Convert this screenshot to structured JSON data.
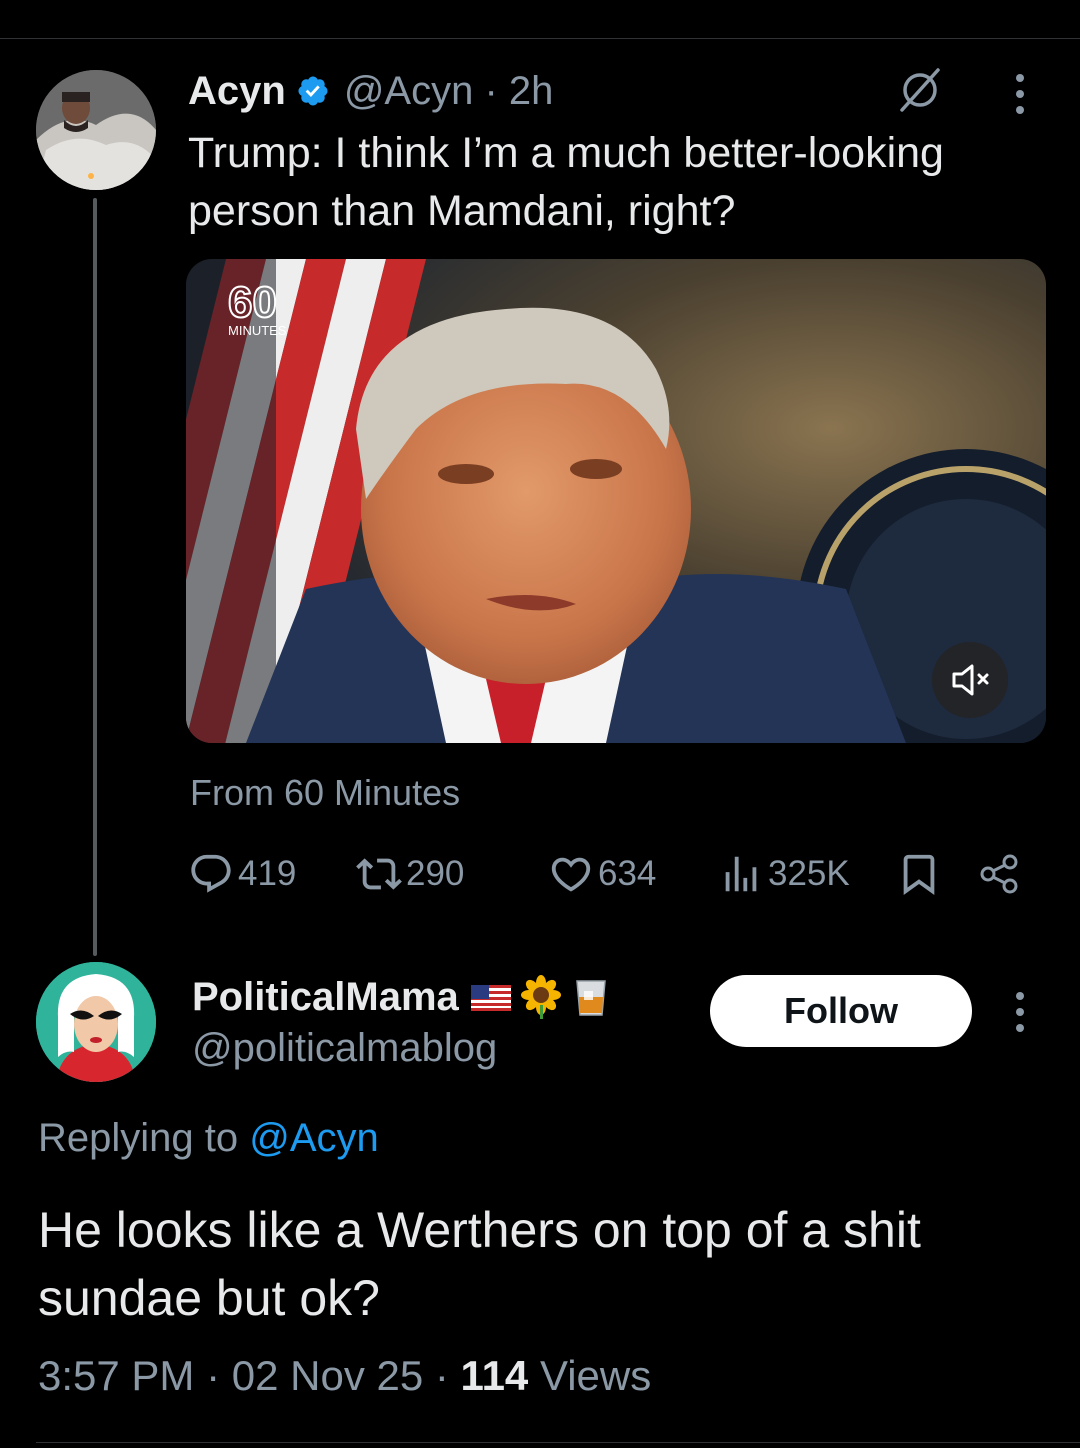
{
  "parent": {
    "name": "Acyn",
    "handle_time": "@Acyn · 2h",
    "text": "Trump: I think I’m a much better-looking person than Mamdani, right?",
    "media": {
      "logo_number": "60",
      "logo_text": "MINUTES"
    },
    "source": "From 60 Minutes",
    "actions": {
      "replies": "419",
      "reposts": "290",
      "likes": "634",
      "views": "325K"
    }
  },
  "reply": {
    "name": "PoliticalMama",
    "handle": "@politicalmablog",
    "follow_label": "Follow",
    "replying_prefix": "Replying to",
    "replying_mention": "@Acyn",
    "text": "He looks like a Werthers on top of a shit sundae but ok?",
    "time_date": "3:57 PM · 02 Nov 25 · ",
    "views_count": "114",
    "views_label": " Views"
  },
  "icons": {
    "verified": "verified-badge-icon",
    "grok": "grok-icon",
    "more": "more-vertical-icon",
    "mute": "speaker-muted-icon",
    "reply": "reply-icon",
    "repost": "repost-icon",
    "like": "heart-icon",
    "views": "bar-chart-icon",
    "bookmark": "bookmark-icon",
    "share": "share-icon",
    "flag": "us-flag-emoji",
    "sunflower": "sunflower-emoji",
    "whiskey": "tumbler-glass-emoji"
  },
  "colors": {
    "background": "#000000",
    "text_primary": "#e7e9ea",
    "text_secondary": "#8b98a5",
    "accent": "#1d9bf0",
    "follow_bg": "#ffffff"
  }
}
